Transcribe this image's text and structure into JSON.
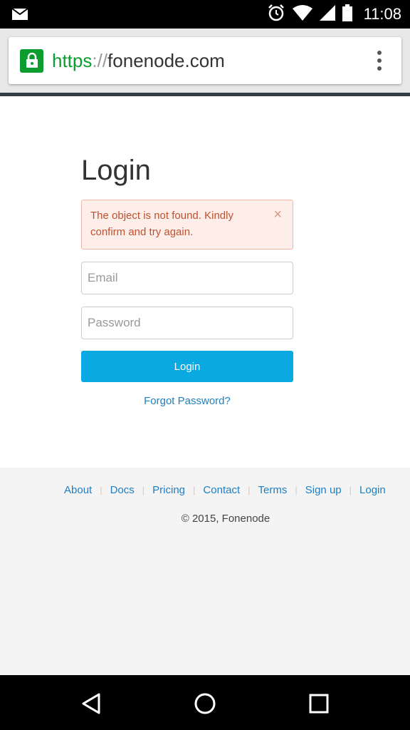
{
  "status_bar": {
    "time": "11:08",
    "icons": [
      "mail-icon",
      "alarm-icon",
      "wifi-icon",
      "signal-icon",
      "battery-icon"
    ]
  },
  "browser": {
    "url_scheme": "https",
    "url_separator": "://",
    "url_host": "fonenode.com",
    "secure_color": "#0b9d2e"
  },
  "login": {
    "title": "Login",
    "alert_message": "The object is not found. Kindly confirm and try again.",
    "alert_close": "×",
    "email_placeholder": "Email",
    "password_placeholder": "Password",
    "submit_label": "Login",
    "forgot_label": "Forgot Password?",
    "button_color": "#0aa9e2"
  },
  "footer": {
    "links": [
      "About",
      "Docs",
      "Pricing",
      "Contact",
      "Terms",
      "Sign up",
      "Login"
    ],
    "separator": "|",
    "copyright": "© 2015, Fonenode"
  }
}
